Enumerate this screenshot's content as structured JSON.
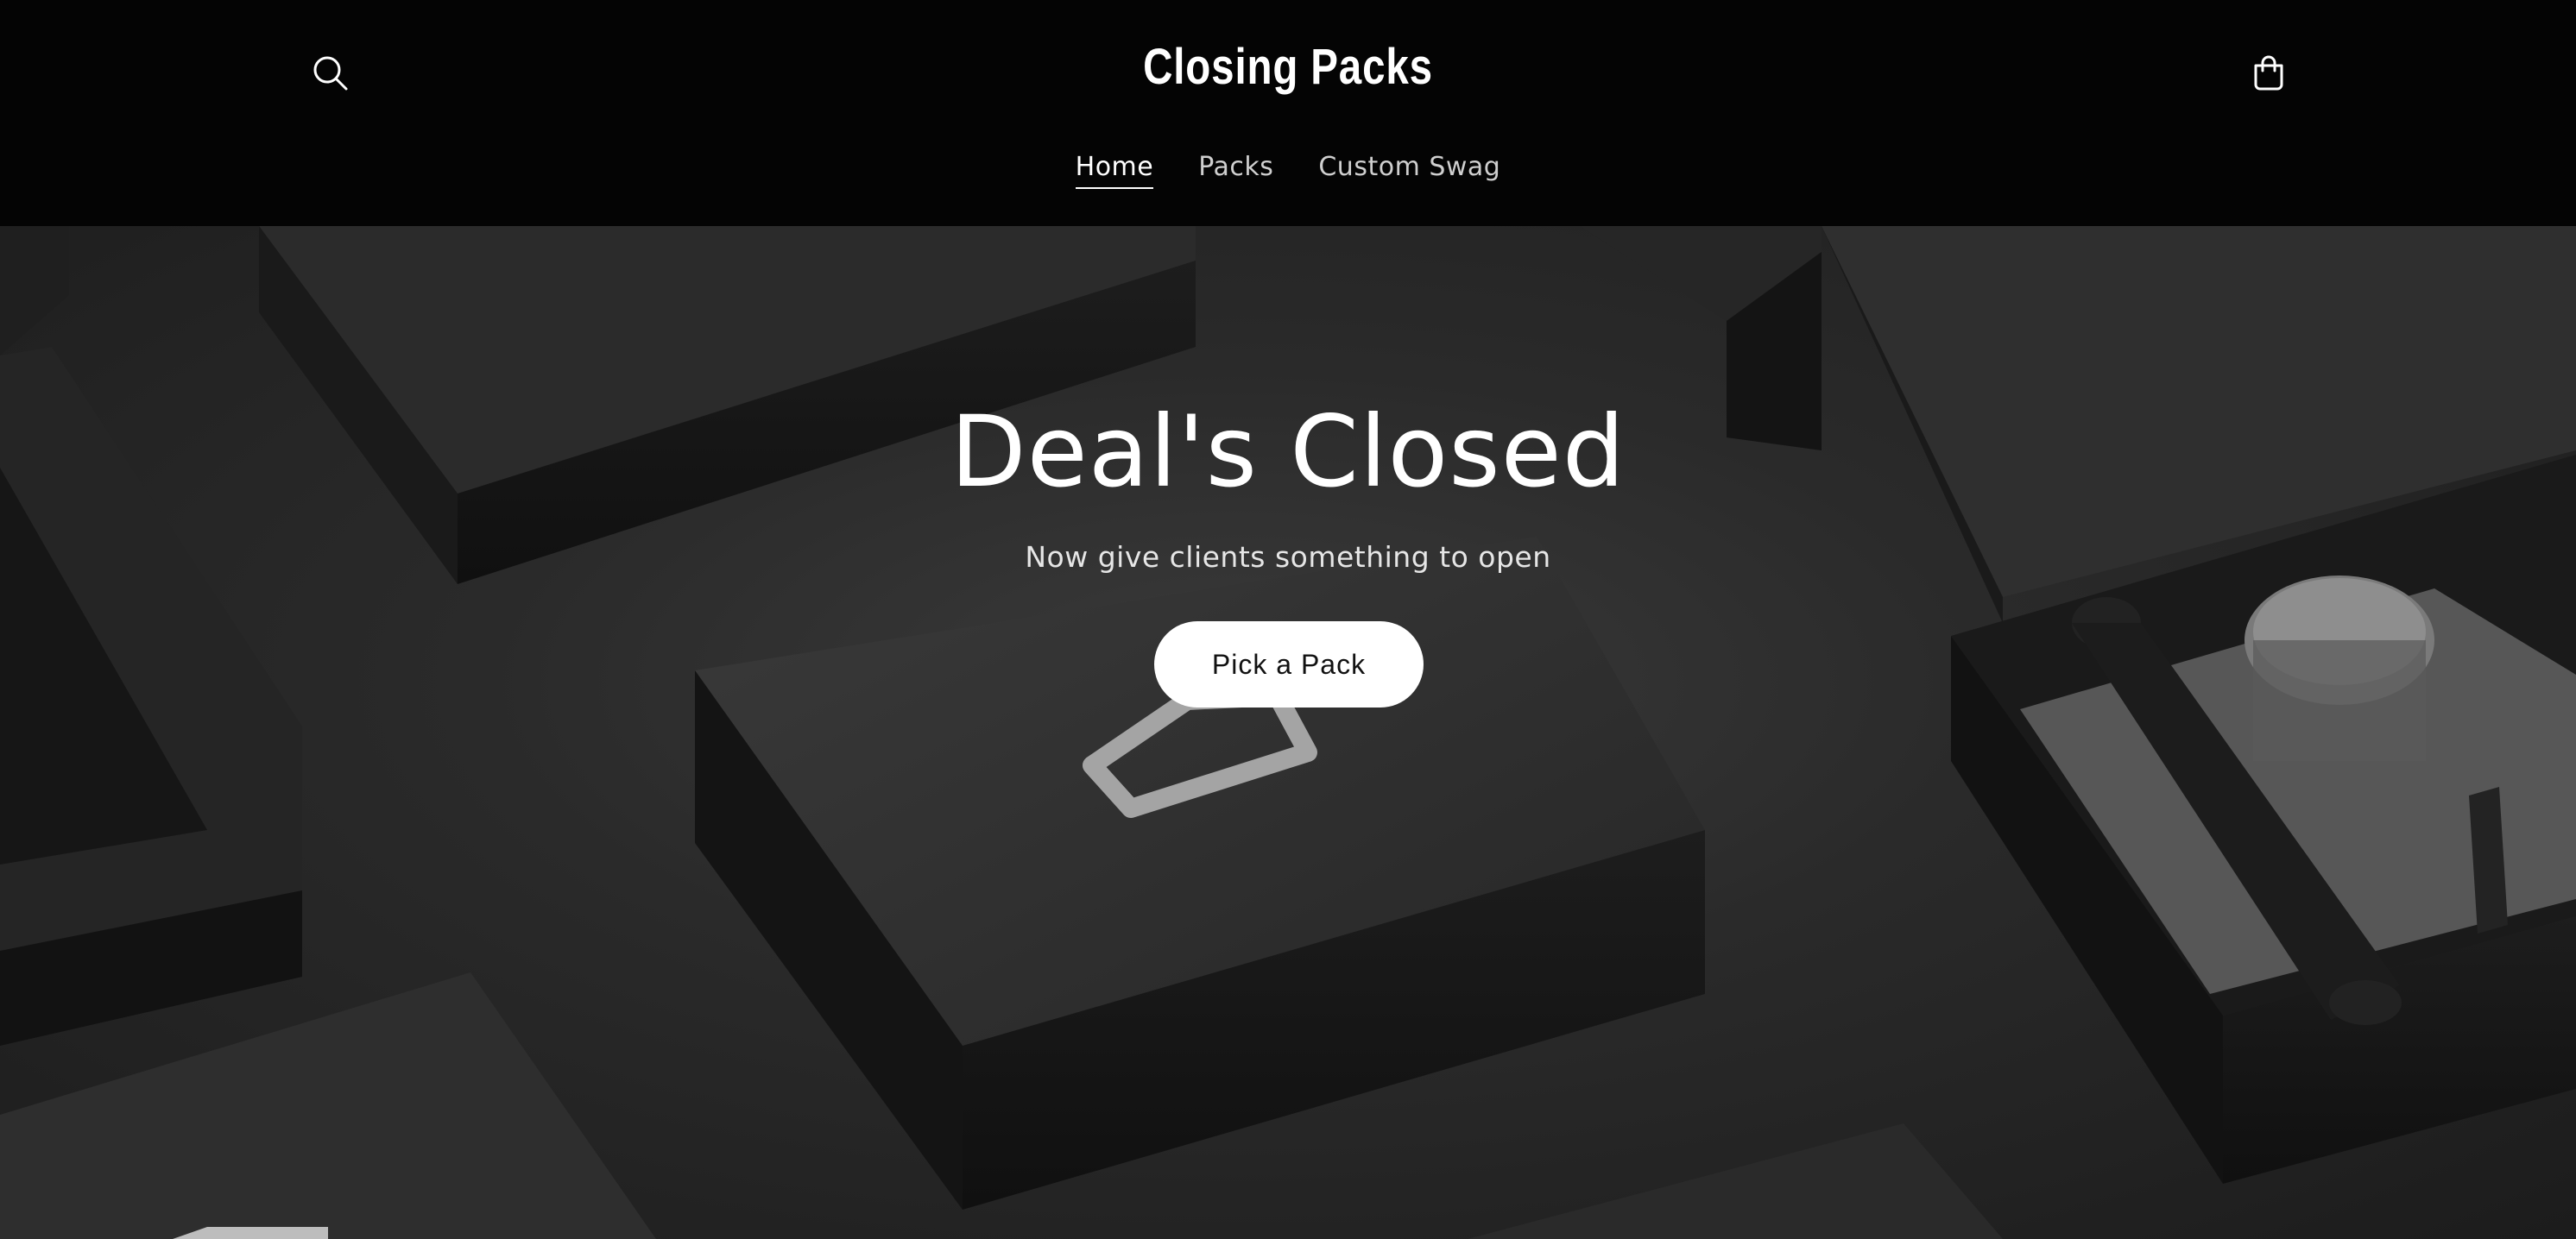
{
  "header": {
    "logo": "Closing Packs",
    "search_icon": "search-icon",
    "cart_icon": "cart-icon",
    "nav": [
      {
        "label": "Home",
        "active": true
      },
      {
        "label": "Packs",
        "active": false
      },
      {
        "label": "Custom Swag",
        "active": false
      }
    ]
  },
  "hero": {
    "title": "Deal's Closed",
    "subtitle": "Now give clients something to open",
    "cta_label": "Pick a Pack"
  },
  "colors": {
    "header_bg": "#040404",
    "text": "#ffffff",
    "button_bg": "#ffffff",
    "button_text": "#111111"
  }
}
